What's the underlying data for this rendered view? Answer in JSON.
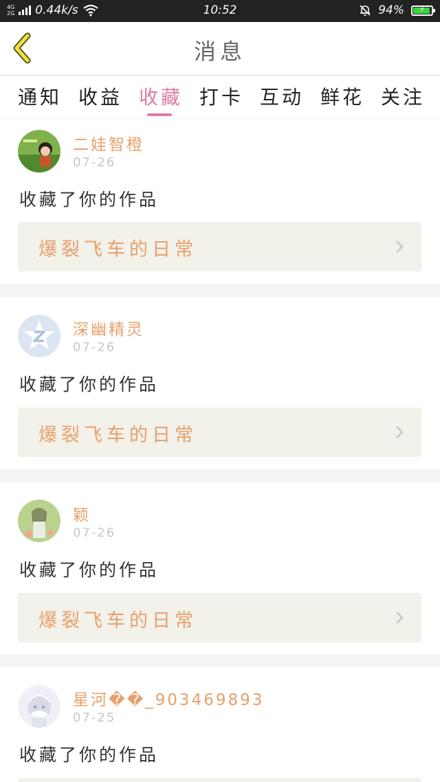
{
  "status_bar": {
    "net_top": "4G",
    "net_bottom": "2G",
    "speed": "0.44k/s",
    "time": "10:52",
    "battery_percent": "94%",
    "battery_level": 0.94
  },
  "header": {
    "title": "消息"
  },
  "tabs": [
    {
      "label": "通知"
    },
    {
      "label": "收益"
    },
    {
      "label": "收藏"
    },
    {
      "label": "打卡"
    },
    {
      "label": "互动"
    },
    {
      "label": "鲜花"
    },
    {
      "label": "关注"
    }
  ],
  "active_tab": "收藏",
  "feed": [
    {
      "username": "二娃智橙",
      "date": "07-26",
      "action": "收藏了你的作品",
      "work_title": "爆裂飞车的日常"
    },
    {
      "username": "深幽精灵",
      "date": "07-26",
      "action": "收藏了你的作品",
      "work_title": "爆裂飞车的日常"
    },
    {
      "username": "颖",
      "date": "07-26",
      "action": "收藏了你的作品",
      "work_title": "爆裂飞车的日常"
    },
    {
      "username": "星河��_903469893",
      "date": "07-25",
      "action": "收藏了你的作品",
      "work_title": ""
    }
  ],
  "colors": {
    "accent_pink": "#e07aa6",
    "accent_orange": "#e8a06a",
    "status_bar": "#222222",
    "battery_green": "#3bd23b"
  }
}
